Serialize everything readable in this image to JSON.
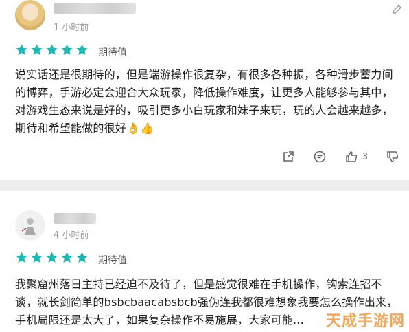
{
  "comments": [
    {
      "time": "1 小时前",
      "rating_label": "期待值",
      "stars": 5,
      "text": "说实话还是很期待的，但是端游操作很复杂，有很多各种振，各种滑步蓄力间的博弈，手游必定会迎合大众玩家，降低操作难度，让更多人能够参与其中，对游戏生态来说是好的，吸引更多小白玩家和妹子来玩，玩的人会越来越多，期待和希望能做的很好👌👍",
      "like_count": "3"
    },
    {
      "time": "4 小时前",
      "rating_label": "期待值",
      "stars": 5,
      "text": "我聚窟州落日主持已经迫不及待了，但是感觉很难在手机操作，钩索连招不谈，就长剑简单的bsbcbaacabsbcb强伪连我都很难想象我要怎么操作出来，手机局限还是太大了，如果复杂操作不易施展，大家可能..."
    }
  ],
  "watermark": "天成手游网",
  "colors": {
    "star": "#1fb7b3",
    "background": "#ededed",
    "card": "#ffffff"
  },
  "icons": [
    "share-icon",
    "reply-icon",
    "like-icon",
    "dislike-icon",
    "star-icon",
    "more-icon"
  ]
}
